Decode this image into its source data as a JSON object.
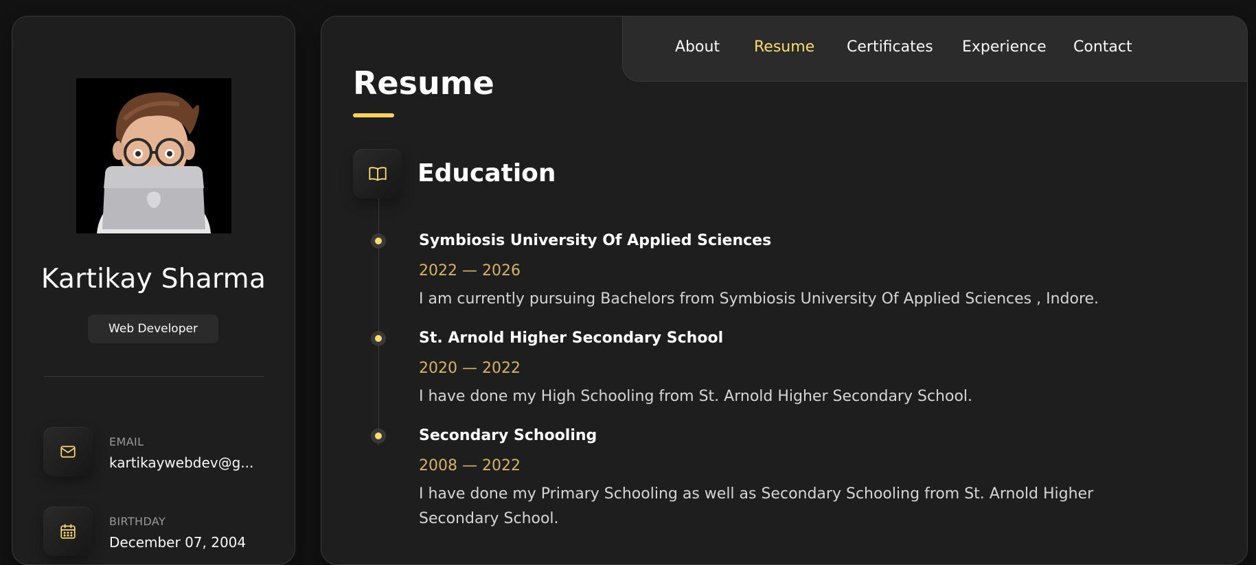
{
  "sidebar": {
    "avatar_alt": "Memoji avatar with laptop",
    "name": "Kartikay Sharma",
    "role": "Web Developer",
    "contacts": [
      {
        "label": "EMAIL",
        "value": "kartikaywebdev@g...",
        "icon": "mail-icon"
      },
      {
        "label": "BIRTHDAY",
        "value": "December 07, 2004",
        "icon": "calendar-icon"
      }
    ]
  },
  "nav": {
    "items": [
      {
        "label": "About",
        "active": false
      },
      {
        "label": "Resume",
        "active": true
      },
      {
        "label": "Certificates",
        "active": false
      },
      {
        "label": "Experience",
        "active": false
      },
      {
        "label": "Contact",
        "active": false
      }
    ]
  },
  "main": {
    "title": "Resume",
    "section": {
      "title": "Education",
      "icon": "book-open-icon",
      "items": [
        {
          "title": "Symbiosis University Of Applied Sciences",
          "date": "2022 — 2026",
          "text": "I am currently pursuing Bachelors from Symbiosis University Of Applied Sciences , Indore."
        },
        {
          "title": "St. Arnold Higher Secondary School",
          "date": "2020 — 2022",
          "text": "I have done my High Schooling from St. Arnold Higher Secondary School."
        },
        {
          "title": "Secondary Schooling",
          "date": "2008 — 2022",
          "text": "I have done my Primary Schooling as well as Secondary Schooling from St. Arnold Higher Secondary School."
        }
      ]
    }
  },
  "colors": {
    "accent": "#ffdb70",
    "background": "#121212",
    "card": "#1e1e1f"
  }
}
